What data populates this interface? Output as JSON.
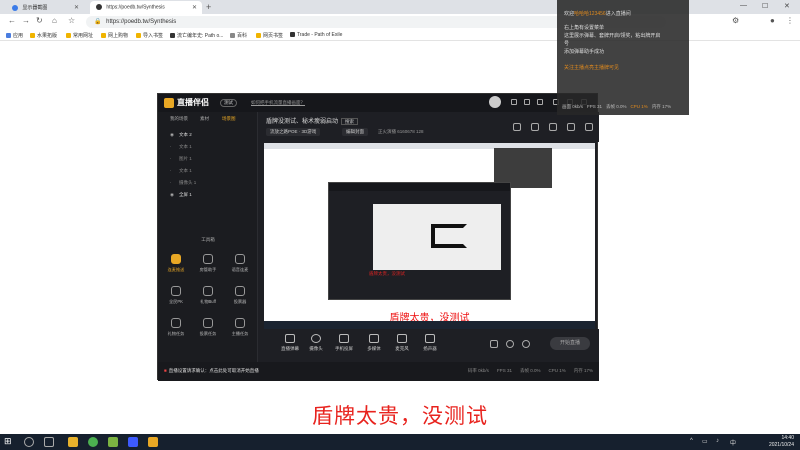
{
  "browser": {
    "tabs": [
      {
        "title": "显示器截图",
        "active": false
      },
      {
        "title": "https://poedb.tw/Synthesis",
        "active": true
      }
    ],
    "address": "https://poedb.tw/Synthesis",
    "new_tab": "+",
    "window_controls": [
      "—",
      "☐",
      "✕"
    ],
    "bookmarks": [
      "应用",
      "水果拓版",
      "常用网址",
      "网上购物",
      "导入书签",
      "流亡编年史: Path o...",
      "百科",
      "网页书签",
      "Trade - Path of Exile"
    ]
  },
  "overlay": {
    "line1_prefix": "欢迎",
    "line1_name": "哈哈哈123456",
    "line1_mid": "进入直播间",
    "lines": [
      "右上角有设置菜单",
      "这里展示弹幕、套牌开启/领奖，粘出牌开启",
      "号",
      "添加弹幕助手成功"
    ],
    "orange_line": "关注主播点亮主播牌可见",
    "stats": [
      "画面 0kb/s",
      "FPS 31",
      "丢帧 0.0%",
      "CPU 1%",
      "内存 17%"
    ]
  },
  "app": {
    "logo": "直播伴侣",
    "version": "测试",
    "announcement": "如何把手机流量直播画面？",
    "sidebar_tabs": [
      "我的场景",
      "素材",
      "场景图"
    ],
    "layers": [
      {
        "name": "文本 2",
        "visible": true
      },
      {
        "name": "文本 1",
        "visible": false
      },
      {
        "name": "图片 1",
        "visible": false
      },
      {
        "name": "文本 1",
        "visible": false
      },
      {
        "name": "摄像头 1",
        "visible": false
      },
      {
        "name": "全屏 1",
        "visible": true
      }
    ],
    "tools_title": "工具箱",
    "tools": [
      {
        "label": "连麦推送",
        "hot": true
      },
      {
        "label": "房管助手",
        "hot": false
      },
      {
        "label": "语音连麦",
        "hot": false
      },
      {
        "label": "全民PK",
        "hot": false
      },
      {
        "label": "礼物Buff",
        "hot": false
      },
      {
        "label": "投票器",
        "hot": false
      },
      {
        "label": "礼物任务",
        "hot": false
      },
      {
        "label": "投票任务",
        "hot": false
      },
      {
        "label": "主播任务",
        "hot": false
      }
    ],
    "scene_title": "盾牌没测试、秘术瘦弱启动",
    "scene_tag": "搜索",
    "game": "流放之路POE · 3D游戏",
    "edit": "编辑封面",
    "live_meta": "正火演播    6160678    128",
    "preview_caption": "盾牌太贵，没测试",
    "inner_caption": "盾牌太贵，没测试",
    "bottom_buttons": [
      "直播弹幕",
      "摄像头",
      "手机投屏",
      "多媒体",
      "麦克风",
      "扬声器"
    ],
    "start_live": "开始直播",
    "warning": "直播设置请求确认：点击此处可取消开始直播",
    "status_stats": [
      "码率 0kb/s",
      "FPS 31",
      "丢帧 0.0%",
      "CPU 1%",
      "内存 17%"
    ]
  },
  "caption": "盾牌太贵，没测试",
  "taskbar": {
    "time": "14:40",
    "date": "2021/10/24"
  }
}
